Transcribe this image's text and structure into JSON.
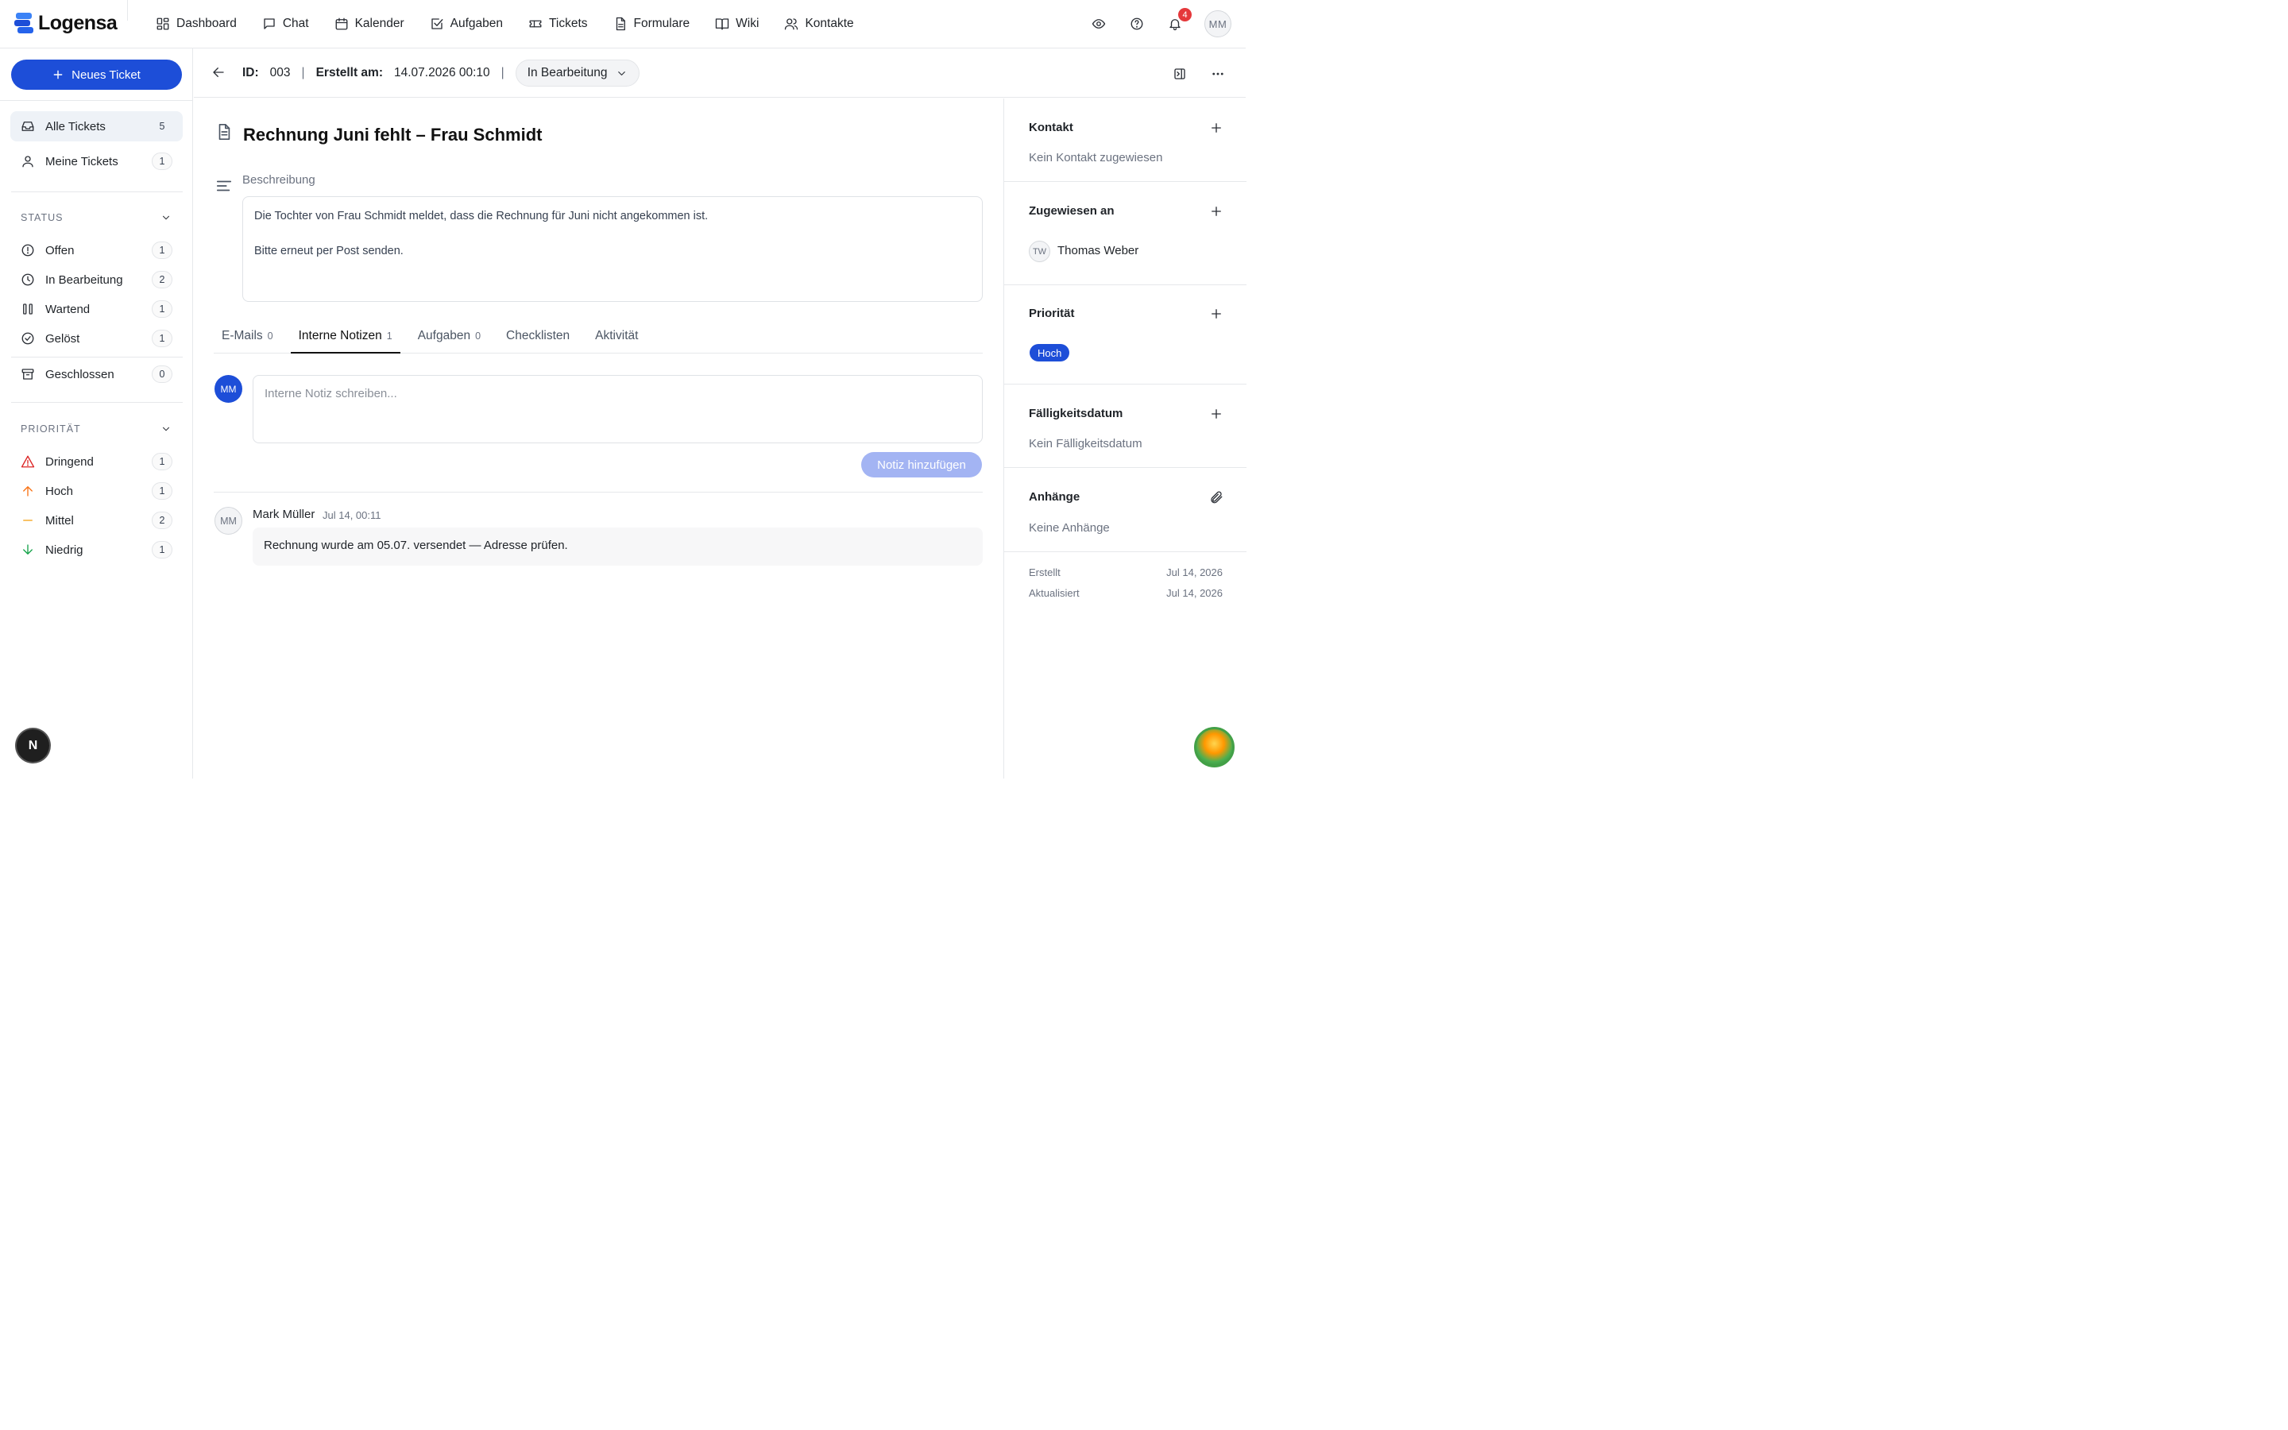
{
  "app": {
    "name": "Logensa",
    "brand_color": "#1d4ed8"
  },
  "nav": [
    {
      "label": "Dashboard",
      "icon": "dashboard-icon"
    },
    {
      "label": "Chat",
      "icon": "chat-icon"
    },
    {
      "label": "Kalender",
      "icon": "calendar-icon"
    },
    {
      "label": "Aufgaben",
      "icon": "checkbox-icon"
    },
    {
      "label": "Tickets",
      "icon": "ticket-icon"
    },
    {
      "label": "Formulare",
      "icon": "document-icon"
    },
    {
      "label": "Wiki",
      "icon": "book-icon"
    },
    {
      "label": "Kontakte",
      "icon": "users-icon"
    }
  ],
  "topbar": {
    "notification_count": "4",
    "user_initials": "MM"
  },
  "sidebar": {
    "new_ticket_label": "Neues Ticket",
    "views": [
      {
        "label": "Alle Tickets",
        "count": "5",
        "icon": "inbox-icon"
      },
      {
        "label": "Meine Tickets",
        "count": "1",
        "icon": "user-icon"
      }
    ],
    "status_heading": "STATUS",
    "status": [
      {
        "label": "Offen",
        "count": "1",
        "icon": "alert-circle-icon"
      },
      {
        "label": "In Bearbeitung",
        "count": "2",
        "icon": "clock-icon"
      },
      {
        "label": "Wartend",
        "count": "1",
        "icon": "pause-icon"
      },
      {
        "label": "Gelöst",
        "count": "1",
        "icon": "check-circle-icon"
      },
      {
        "label": "Geschlossen",
        "count": "0",
        "icon": "archive-icon"
      }
    ],
    "priority_heading": "PRIORITÄT",
    "priority": [
      {
        "label": "Dringend",
        "count": "1",
        "icon": "warning-triangle-icon",
        "color": "#dc2626"
      },
      {
        "label": "Hoch",
        "count": "1",
        "icon": "arrow-up-icon",
        "color": "#f97316"
      },
      {
        "label": "Mittel",
        "count": "2",
        "icon": "minus-icon",
        "color": "#f59e0b"
      },
      {
        "label": "Niedrig",
        "count": "1",
        "icon": "arrow-down-icon",
        "color": "#16a34a"
      }
    ],
    "help_badge": "N"
  },
  "ticket": {
    "id_label": "ID:",
    "id": "003",
    "created_label": "Erstellt am:",
    "created": "14.07.2026 00:10",
    "status": "In Bearbeitung",
    "title": "Rechnung Juni fehlt – Frau Schmidt",
    "description_label": "Beschreibung",
    "description_line1": "Die Tochter von Frau Schmidt meldet, dass die Rechnung für Juni nicht angekommen ist.",
    "description_line2": "Bitte erneut per Post senden."
  },
  "tabs": [
    {
      "label": "E-Mails",
      "count": "0"
    },
    {
      "label": "Interne Notizen",
      "count": "1"
    },
    {
      "label": "Aufgaben",
      "count": "0"
    },
    {
      "label": "Checklisten",
      "count": ""
    },
    {
      "label": "Aktivität",
      "count": ""
    }
  ],
  "notes": {
    "author_initials": "MM",
    "placeholder": "Interne Notiz schreiben...",
    "submit_label": "Notiz hinzufügen",
    "items": [
      {
        "initials": "MM",
        "author": "Mark Müller",
        "time": "Jul 14, 00:11",
        "text": "Rechnung wurde am 05.07. versendet — Adresse prüfen."
      }
    ]
  },
  "details": {
    "contact_title": "Kontakt",
    "contact_empty": "Kein Kontakt zugewiesen",
    "assigned_title": "Zugewiesen an",
    "assignee_initials": "TW",
    "assignee_name": "Thomas Weber",
    "priority_title": "Priorität",
    "priority_value": "Hoch",
    "due_title": "Fälligkeitsdatum",
    "due_empty": "Kein Fälligkeitsdatum",
    "attachments_title": "Anhänge",
    "attachments_empty": "Keine Anhänge",
    "created_label": "Erstellt",
    "created_value": "Jul 14, 2026",
    "updated_label": "Aktualisiert",
    "updated_value": "Jul 14, 2026"
  }
}
